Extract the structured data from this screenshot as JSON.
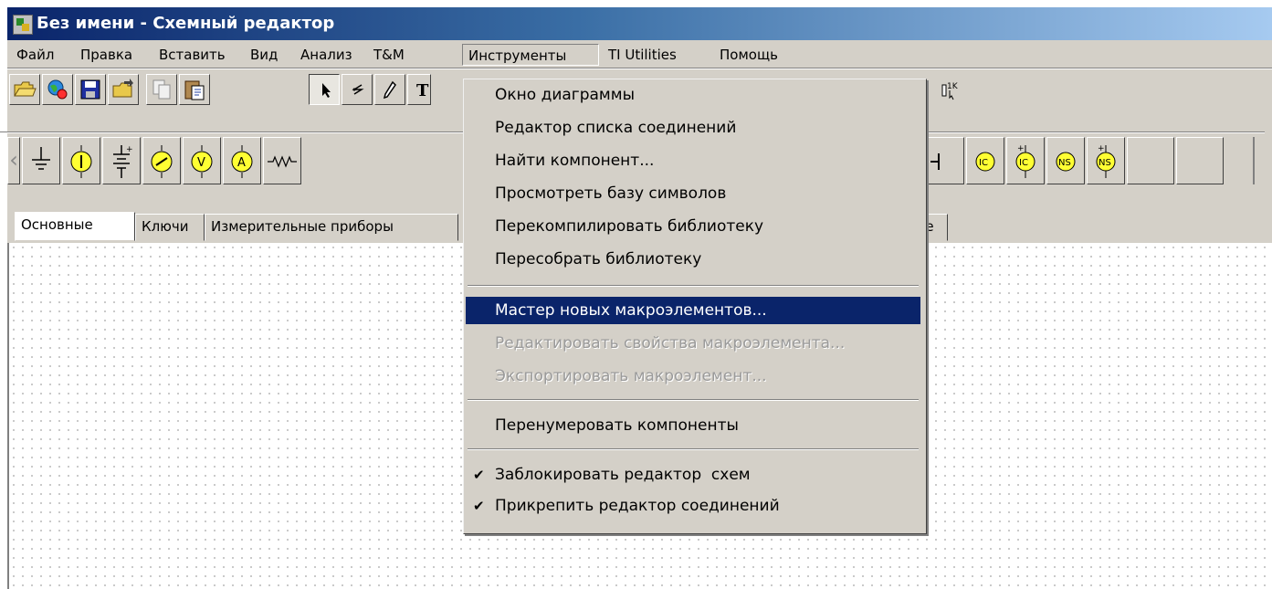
{
  "window": {
    "title": "Без имени - Схемный редактор"
  },
  "menubar": {
    "items": [
      "Файл",
      "Правка",
      "Вставить",
      "Вид",
      "Анализ",
      "T&M",
      "Инструменты",
      "TI Utilities",
      "Помощь"
    ],
    "open_item": "Инструменты"
  },
  "tools_menu": {
    "items": [
      {
        "label": "Окно диаграммы",
        "state": "normal"
      },
      {
        "label": "Редактор списка соединений",
        "state": "normal"
      },
      {
        "label": "Найти компонент...",
        "state": "normal"
      },
      {
        "label": "Просмотреть базу символов",
        "state": "normal"
      },
      {
        "label": "Перекомпилировать библиотеку",
        "state": "normal"
      },
      {
        "label": "Пересобрать библиотеку",
        "state": "normal"
      },
      {
        "label": "Мастер новых макроэлементов...",
        "state": "highlighted"
      },
      {
        "label": "Редактировать свойства макроэлемента...",
        "state": "disabled"
      },
      {
        "label": "Экспортировать макроэлемент...",
        "state": "disabled"
      },
      {
        "label": "Перенумеровать компоненты",
        "state": "normal"
      },
      {
        "label": "Заблокировать редактор  схем",
        "state": "checked"
      },
      {
        "label": "Прикрепить редактор соединений",
        "state": "checked"
      }
    ]
  },
  "toolbar": {
    "buttons": [
      "open-folder-icon",
      "globe-icon",
      "save-icon",
      "open-icon",
      "copy-icon",
      "paste-icon",
      "select-arrow-icon",
      "wire-icon",
      "pencil-icon",
      "text-icon",
      "resistor-1k-icon"
    ],
    "text_button_label": "T",
    "resistor_label": "1K"
  },
  "components": {
    "buttons": [
      "ground-icon",
      "dc-current-source-icon",
      "battery-icon",
      "ac-source-icon",
      "voltmeter-icon",
      "ammeter-icon",
      "resistor-icon",
      "capacitor-icon",
      "ic-icon",
      "ic-plus-icon",
      "ns-icon",
      "ns-plus-icon"
    ],
    "labels": {
      "voltmeter": "V",
      "ammeter": "A",
      "ic": "IC",
      "ns": "NS"
    }
  },
  "tabs": {
    "items": [
      "Основные",
      "Ключи",
      "Измерительные приборы"
    ],
    "partial": "ice",
    "active": "Основные"
  },
  "colors": {
    "title_start": "#0a246a",
    "title_end": "#a6caf0",
    "menu_highlight": "#0a246a",
    "chrome": "#d4d0c8",
    "component_fill": "#ffff33"
  }
}
